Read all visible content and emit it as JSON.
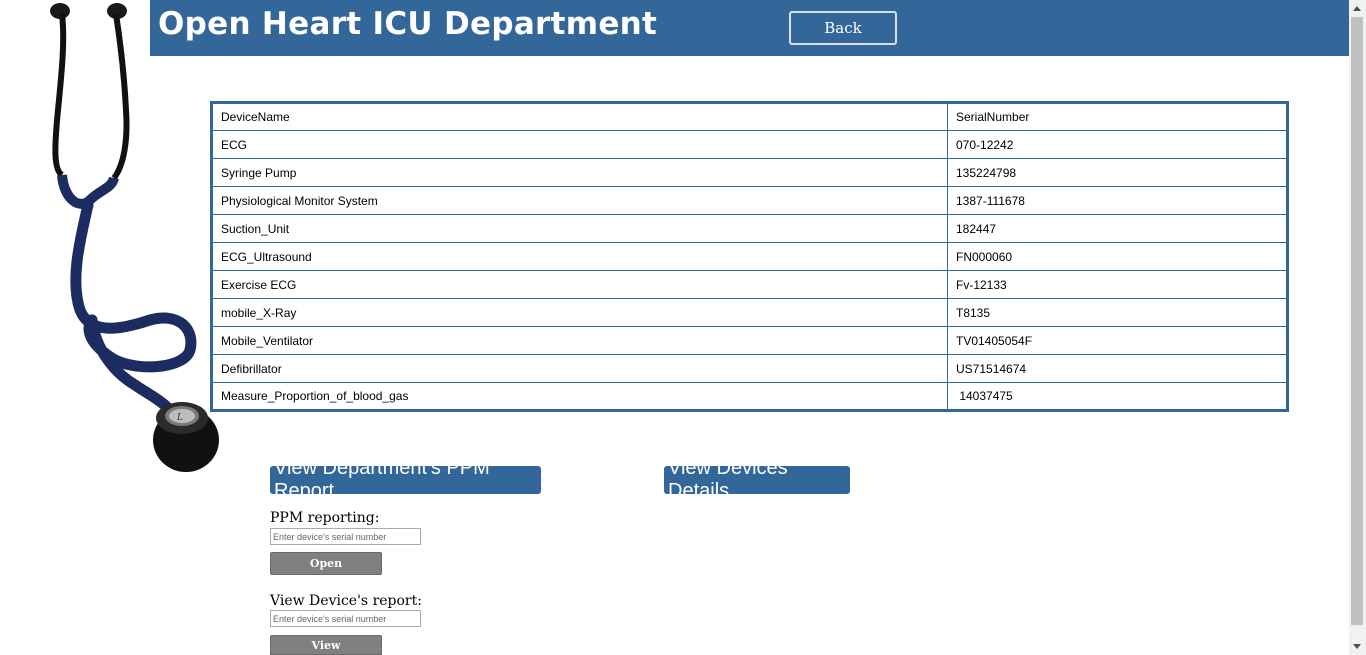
{
  "header": {
    "title": "Open Heart ICU Department",
    "back_label": "Back",
    "bg_color": "#336699"
  },
  "table": {
    "columns": [
      "DeviceName",
      "SerialNumber"
    ],
    "rows": [
      [
        "ECG",
        "070-12242"
      ],
      [
        "Syringe Pump",
        "135224798"
      ],
      [
        "Physiological Monitor System",
        "1387-111678"
      ],
      [
        "Suction_Unit",
        "182447"
      ],
      [
        "ECG_Ultrasound",
        "FN000060"
      ],
      [
        "Exercise ECG",
        "Fv-12133"
      ],
      [
        "mobile_X-Ray",
        "T8135"
      ],
      [
        "Mobile_Ventilator",
        "TV01405054F"
      ],
      [
        "Defibrillator",
        "US71514674"
      ],
      [
        "Measure_Proportion_of_blood_gas",
        " 14037475"
      ]
    ]
  },
  "actions": {
    "ppm_report_label": "View Department's PPM Report",
    "devices_details_label": "View Devices' Details"
  },
  "ppm_form": {
    "label": "PPM reporting:",
    "placeholder": "Enter device's serial number",
    "button_label": "Open"
  },
  "report_form": {
    "label": "View Device's report:",
    "placeholder": "Enter device's serial number",
    "button_label": "View"
  },
  "icons": {
    "decoration": "stethoscope-image"
  }
}
